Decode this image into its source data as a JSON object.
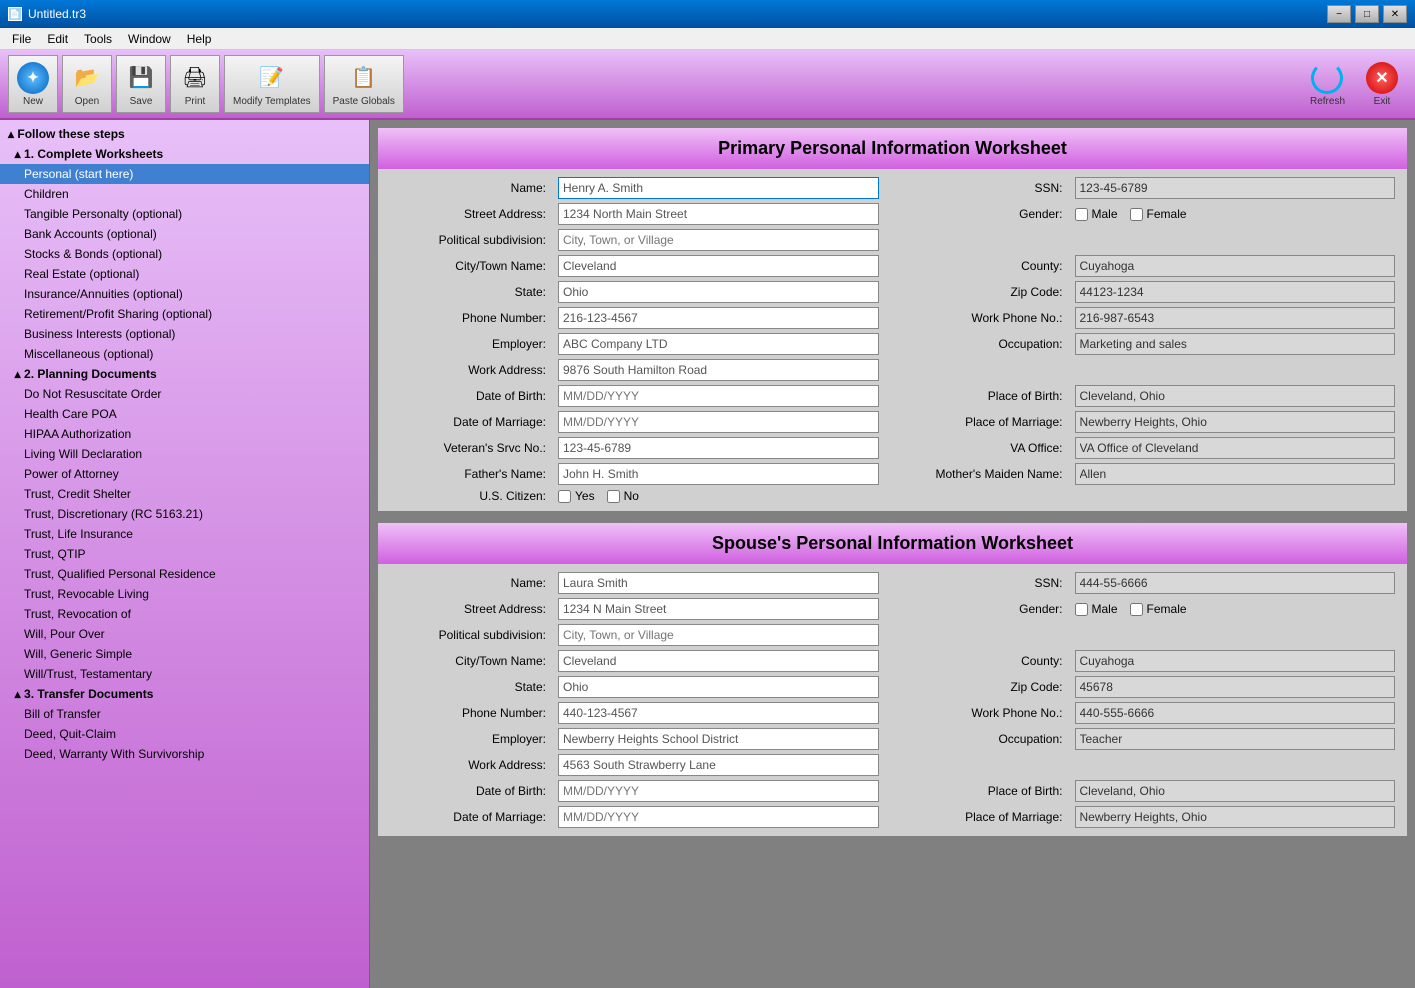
{
  "titleBar": {
    "title": "Untitled.tr3",
    "icon": "📄"
  },
  "menuBar": {
    "items": [
      "File",
      "Edit",
      "Tools",
      "Window",
      "Help"
    ]
  },
  "toolbar": {
    "buttons": [
      {
        "label": "New",
        "icon": "new"
      },
      {
        "label": "Open",
        "icon": "open"
      },
      {
        "label": "Save",
        "icon": "save"
      },
      {
        "label": "Print",
        "icon": "print"
      },
      {
        "label": "Modify Templates",
        "icon": "modify"
      },
      {
        "label": "Paste Globals",
        "icon": "paste"
      }
    ],
    "rightButtons": [
      {
        "label": "Refresh",
        "icon": "refresh"
      },
      {
        "label": "Exit",
        "icon": "exit"
      }
    ]
  },
  "sidebar": {
    "followText": "Follow these steps",
    "sections": [
      {
        "label": "1. Complete Worksheets",
        "items": [
          {
            "label": "Personal (start here)",
            "active": true
          },
          {
            "label": "Children"
          },
          {
            "label": "Tangible Personalty (optional)"
          },
          {
            "label": "Bank Accounts (optional)"
          },
          {
            "label": "Stocks & Bonds (optional)"
          },
          {
            "label": "Real Estate (optional)"
          },
          {
            "label": "Insurance/Annuities (optional)"
          },
          {
            "label": "Retirement/Profit Sharing (optional)"
          },
          {
            "label": "Business Interests (optional)"
          },
          {
            "label": "Miscellaneous (optional)"
          }
        ]
      },
      {
        "label": "2. Planning Documents",
        "items": [
          {
            "label": "Do Not Resuscitate Order"
          },
          {
            "label": "Health Care POA"
          },
          {
            "label": "HIPAA Authorization"
          },
          {
            "label": "Living Will Declaration"
          },
          {
            "label": "Power of Attorney"
          },
          {
            "label": "Trust, Credit Shelter"
          },
          {
            "label": "Trust, Discretionary (RC 5163.21)"
          },
          {
            "label": "Trust, Life Insurance"
          },
          {
            "label": "Trust, QTIP"
          },
          {
            "label": "Trust, Qualified Personal Residence"
          },
          {
            "label": "Trust, Revocable Living"
          },
          {
            "label": "Trust, Revocation of"
          },
          {
            "label": "Will, Pour Over"
          },
          {
            "label": "Will, Generic Simple"
          },
          {
            "label": "Will/Trust, Testamentary"
          }
        ]
      },
      {
        "label": "3. Transfer Documents",
        "items": [
          {
            "label": "Bill of Transfer"
          },
          {
            "label": "Deed, Quit-Claim"
          },
          {
            "label": "Deed, Warranty With Survivorship"
          }
        ]
      }
    ]
  },
  "primaryWorksheet": {
    "title": "Primary Personal Information Worksheet",
    "fields": {
      "name_label": "Name:",
      "name_value": "Henry A. Smith",
      "ssn_label": "SSN:",
      "ssn_value": "123-45-6789",
      "street_label": "Street Address:",
      "street_value": "1234 North Main Street",
      "gender_label": "Gender:",
      "gender_male": "Male",
      "gender_female": "Female",
      "polsub_label": "Political subdivision:",
      "polsub_placeholder": "City, Town, or Village",
      "city_label": "City/Town Name:",
      "city_value": "Cleveland",
      "county_label": "County:",
      "county_value": "Cuyahoga",
      "state_label": "State:",
      "state_value": "Ohio",
      "zip_label": "Zip Code:",
      "zip_value": "44123-1234",
      "phone_label": "Phone Number:",
      "phone_value": "216-123-4567",
      "workphone_label": "Work Phone No.:",
      "workphone_value": "216-987-6543",
      "employer_label": "Employer:",
      "employer_value": "ABC Company LTD",
      "occupation_label": "Occupation:",
      "occupation_value": "Marketing and sales",
      "workaddr_label": "Work Address:",
      "workaddr_value": "9876 South Hamilton Road",
      "dob_label": "Date of Birth:",
      "dob_placeholder": "MM/DD/YYYY",
      "pob_label": "Place of Birth:",
      "pob_value": "Cleveland, Ohio",
      "dom_label": "Date of Marriage:",
      "dom_placeholder": "MM/DD/YYYY",
      "pom_label": "Place of Marriage:",
      "pom_value": "Newberry Heights, Ohio",
      "vet_label": "Veteran's Srvc No.:",
      "vet_value": "123-45-6789",
      "vaoffice_label": "VA Office:",
      "vaoffice_value": "VA Office of Cleveland",
      "father_label": "Father's Name:",
      "father_value": "John H. Smith",
      "maiden_label": "Mother's Maiden Name:",
      "maiden_value": "Allen",
      "citizen_label": "U.S. Citizen:",
      "citizen_yes": "Yes",
      "citizen_no": "No"
    }
  },
  "spouseWorksheet": {
    "title": "Spouse's Personal Information Worksheet",
    "fields": {
      "name_label": "Name:",
      "name_value": "Laura Smith",
      "ssn_label": "SSN:",
      "ssn_value": "444-55-6666",
      "street_label": "Street Address:",
      "street_value": "1234 N Main Street",
      "gender_label": "Gender:",
      "gender_male": "Male",
      "gender_female": "Female",
      "polsub_label": "Political subdivision:",
      "polsub_placeholder": "City, Town, or Village",
      "city_label": "City/Town Name:",
      "city_value": "Cleveland",
      "county_label": "County:",
      "county_value": "Cuyahoga",
      "state_label": "State:",
      "state_value": "Ohio",
      "zip_label": "Zip Code:",
      "zip_value": "45678",
      "phone_label": "Phone Number:",
      "phone_value": "440-123-4567",
      "workphone_label": "Work Phone No.:",
      "workphone_value": "440-555-6666",
      "employer_label": "Employer:",
      "employer_value": "Newberry Heights School District",
      "occupation_label": "Occupation:",
      "occupation_value": "Teacher",
      "workaddr_label": "Work Address:",
      "workaddr_value": "4563 South Strawberry Lane",
      "dob_label": "Date of Birth:",
      "dob_placeholder": "MM/DD/YYYY",
      "pob_label": "Place of Birth:",
      "pob_value": "Cleveland, Ohio",
      "dom_label": "Date of Marriage:",
      "dom_placeholder": "MM/DD/YYYY",
      "pom_label": "Place of Marriage:",
      "pom_value": "Newberry Heights, Ohio"
    }
  }
}
